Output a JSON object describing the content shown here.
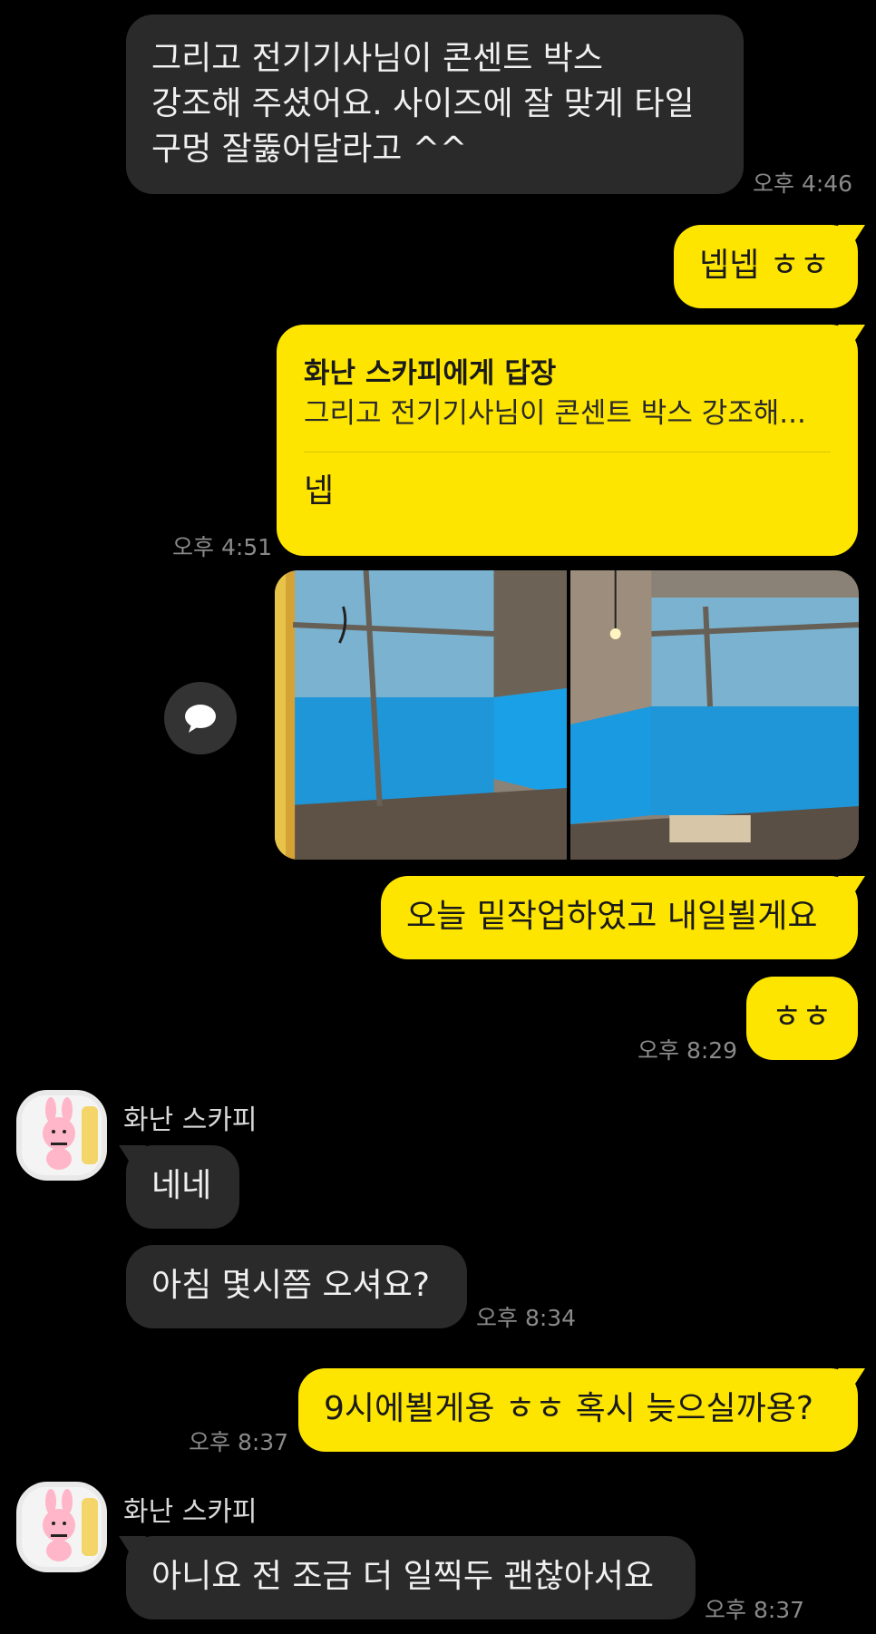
{
  "messages": {
    "m1": {
      "text_line1": "그리고 전기기사님이 콘센트 박스",
      "text_line2": "강조해 주셨어요. 사이즈에 잘 맞게 타일",
      "text_line3": "구멍 잘뚫어달라고 ^^",
      "time": "오후 4:46"
    },
    "m2": {
      "text": "넵넵 ㅎㅎ"
    },
    "m3": {
      "reply_to": "화난 스카피에게 답장",
      "quoted": "그리고 전기기사님이 콘센트 박스 강조해...",
      "text": "넵",
      "time": "오후 4:51"
    },
    "m5": {
      "text": "오늘 밑작업하였고 내일뵐게요"
    },
    "m6": {
      "text": "ㅎㅎ",
      "time": "오후 8:29"
    },
    "m7": {
      "sender": "화난 스카피",
      "text": "네네"
    },
    "m8": {
      "text": "아침 몇시쯤 오셔요?",
      "time": "오후 8:34"
    },
    "m9": {
      "text": "9시에뵐게용 ㅎㅎ 혹시 늦으실까용?",
      "time": "오후 8:37"
    },
    "m10": {
      "sender": "화난 스카피",
      "text": "아니요 전 조금 더 일찍두 괜찮아서요",
      "time": "오후 8:37"
    }
  },
  "icons": {
    "share": "speech-bubble-icon",
    "avatar": "bunny-sticker-avatar"
  },
  "colors": {
    "background": "#000000",
    "outgoing": "#fee500",
    "incoming": "#2a2a2a",
    "time": "#8a8a8a"
  }
}
